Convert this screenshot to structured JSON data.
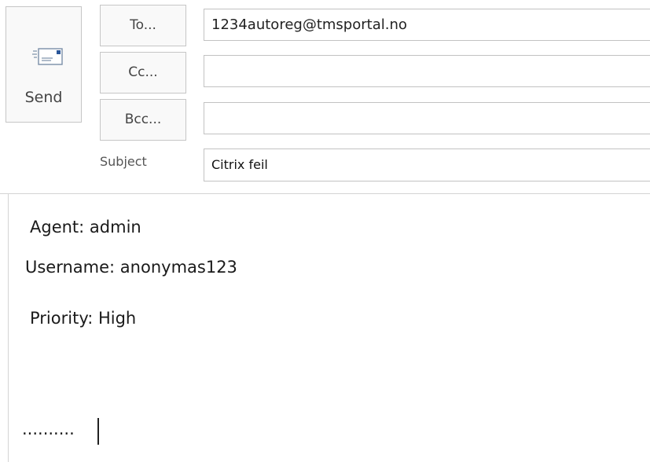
{
  "send_button": {
    "label": "Send",
    "icon": "send-envelope-icon"
  },
  "address_buttons": {
    "to": "To...",
    "cc": "Cc...",
    "bcc": "Bcc..."
  },
  "fields": {
    "to": "1234autoreg@tmsportal.no",
    "cc": "",
    "bcc": "",
    "subject_label": "Subject",
    "subject": "Citrix feil"
  },
  "body": {
    "agent": "Agent: admin",
    "username": "Username: anonymas123",
    "priority": "Priority: High",
    "trailing": ".........."
  },
  "colors": {
    "button_border": "#c6c6c6",
    "field_border": "#c2c2c2",
    "envelope_accent": "#2b579a"
  }
}
